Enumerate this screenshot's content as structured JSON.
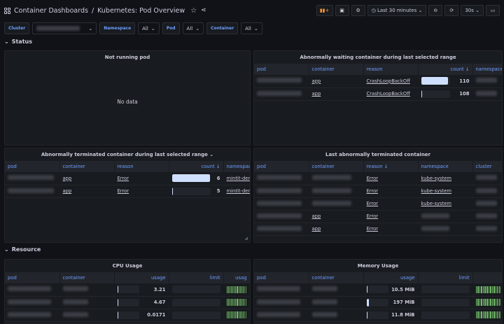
{
  "header": {
    "folder": "Container Dashboards",
    "separator": "/",
    "title": "Kubernetes: Pod Overview",
    "time_range": "Last 30 minutes",
    "refresh": "30s"
  },
  "variables": [
    {
      "label": "Cluster",
      "value": ""
    },
    {
      "label": "Namespace",
      "value": "All"
    },
    {
      "label": "Pod",
      "value": "All"
    },
    {
      "label": "Container",
      "value": "All"
    }
  ],
  "rows": {
    "status": "Status",
    "resource": "Resource"
  },
  "panels": {
    "not_running": {
      "title": "Not running pod",
      "empty": "No data"
    },
    "waiting": {
      "title": "Abnormally waiting container during last selected range",
      "columns": [
        "pod",
        "container",
        "reason",
        "count ↓",
        "namespace"
      ],
      "rows": [
        {
          "container": "app",
          "reason": "CrashLoopBackOff",
          "count": 110,
          "fill": 0.93
        },
        {
          "container": "app",
          "reason": "CrashLoopBackOff",
          "count": 108,
          "fill": 0.01
        }
      ]
    },
    "terminated_range": {
      "title": "Abnormally terminated container during last selected range",
      "columns": [
        "pod",
        "container",
        "reason",
        "count ↓",
        "namespace"
      ],
      "rows": [
        {
          "container": "app",
          "reason": "Error",
          "count": 6,
          "fill": 0.99,
          "namespace": "mintit-dem"
        },
        {
          "container": "app",
          "reason": "Error",
          "count": 5,
          "fill": 0.01,
          "namespace": "mintit-dem"
        }
      ]
    },
    "last_terminated": {
      "title": "Last abnormally terminated container",
      "columns": [
        "pod",
        "container",
        "reason ↓",
        "namespace",
        "cluster"
      ],
      "rows": [
        {
          "container": "",
          "reason": "Error",
          "namespace": "kube-system"
        },
        {
          "container": "",
          "reason": "Error",
          "namespace": "kube-system"
        },
        {
          "container": "",
          "reason": "Error",
          "namespace": "kube-system"
        },
        {
          "container": "app",
          "reason": "Error",
          "namespace": ""
        },
        {
          "container": "app",
          "reason": "Error",
          "namespace": ""
        }
      ]
    },
    "cpu": {
      "title": "CPU Usage",
      "columns": [
        "pod",
        "container",
        "usage",
        "limit",
        "usag"
      ],
      "rows": [
        {
          "usage": "3.21",
          "fill": 0.02
        },
        {
          "usage": "4.67",
          "fill": 0.02
        },
        {
          "usage": "0.0171",
          "fill": 0.01
        }
      ]
    },
    "memory": {
      "title": "Memory Usage",
      "columns": [
        "pod",
        "container",
        "usage",
        "limit"
      ],
      "rows": [
        {
          "usage": "10.5 MiB",
          "fill": 0.02
        },
        {
          "usage": "197 MiB",
          "fill": 0.1
        },
        {
          "usage": "11.8 MiB",
          "fill": 0.02
        }
      ]
    }
  },
  "colors": {
    "background": "#111217",
    "panel": "#181b1f",
    "header_link": "#6e9fff",
    "gauge_fill": "#cfe0ff",
    "lcd_green": "#73bf69"
  }
}
